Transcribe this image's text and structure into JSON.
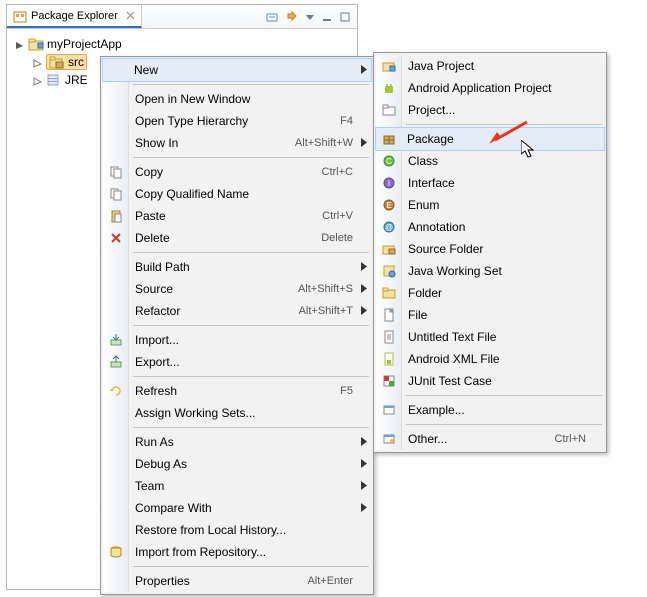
{
  "tab": {
    "title": "Package Explorer"
  },
  "tree": {
    "project": "myProjectApp",
    "src": "src",
    "jre": "JRE"
  },
  "menu": {
    "new": "New",
    "open_new_window": "Open in New Window",
    "open_type_hierarchy": "Open Type Hierarchy",
    "open_type_hierarchy_key": "F4",
    "show_in": "Show In",
    "show_in_key": "Alt+Shift+W",
    "copy": "Copy",
    "copy_key": "Ctrl+C",
    "copy_qualified": "Copy Qualified Name",
    "paste": "Paste",
    "paste_key": "Ctrl+V",
    "delete": "Delete",
    "delete_key": "Delete",
    "build_path": "Build Path",
    "source": "Source",
    "source_key": "Alt+Shift+S",
    "refactor": "Refactor",
    "refactor_key": "Alt+Shift+T",
    "import": "Import...",
    "export": "Export...",
    "refresh": "Refresh",
    "refresh_key": "F5",
    "assign_ws": "Assign Working Sets...",
    "run_as": "Run As",
    "debug_as": "Debug As",
    "team": "Team",
    "compare_with": "Compare With",
    "restore_local": "Restore from Local History...",
    "import_repo": "Import from Repository...",
    "properties": "Properties",
    "properties_key": "Alt+Enter"
  },
  "submenu": {
    "java_project": "Java Project",
    "android_app": "Android Application Project",
    "project": "Project...",
    "package": "Package",
    "class": "Class",
    "interface": "Interface",
    "enum": "Enum",
    "annotation": "Annotation",
    "source_folder": "Source Folder",
    "java_ws": "Java Working Set",
    "folder": "Folder",
    "file": "File",
    "untitled_txt": "Untitled Text File",
    "android_xml": "Android XML File",
    "junit": "JUnit Test Case",
    "example": "Example...",
    "other": "Other...",
    "other_key": "Ctrl+N"
  }
}
